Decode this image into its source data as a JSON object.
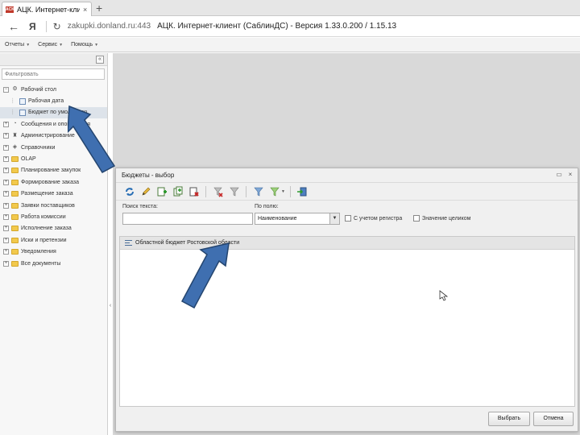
{
  "browser": {
    "tab_title": "АЦК. Интернет-клиент",
    "favicon_text": "ACK",
    "tab_close": "×",
    "new_tab": "+",
    "back": "←",
    "ya": "Я",
    "reload": "↻",
    "url": "zakupki.donland.ru:443",
    "page_title": "АЦК. Интернет-клиент (СаблинДС) - Версия 1.33.0.200 / 1.15.13"
  },
  "menu": {
    "items": [
      "Отчеты",
      "Сервис",
      "Помощь"
    ]
  },
  "left_panel": {
    "collapse": "«",
    "filter_placeholder": "Фильтровать",
    "tree": [
      {
        "label": "Рабочий стол",
        "level": 0,
        "expander": "−",
        "icon": "gear-icon"
      },
      {
        "label": "Рабочая дата",
        "level": 1,
        "icon": "doc-icon"
      },
      {
        "label": "Бюджет по умолчанию",
        "level": 1,
        "icon": "doc-icon",
        "selected": true
      },
      {
        "label": "Сообщения и оповещения",
        "level": 0,
        "expander": "+",
        "icon": "chat-icon"
      },
      {
        "label": "Администрирование",
        "level": 0,
        "expander": "+",
        "icon": "admin-icon"
      },
      {
        "label": "Справочники",
        "level": 0,
        "expander": "+",
        "icon": "book-icon"
      },
      {
        "label": "OLAP",
        "level": 0,
        "expander": "+",
        "icon": "folder-icon"
      },
      {
        "label": "Планирование закупок",
        "level": 0,
        "expander": "+",
        "icon": "folder-icon"
      },
      {
        "label": "Формирование заказа",
        "level": 0,
        "expander": "+",
        "icon": "folder-icon"
      },
      {
        "label": "Размещение заказа",
        "level": 0,
        "expander": "+",
        "icon": "folder-icon"
      },
      {
        "label": "Заявки поставщиков",
        "level": 0,
        "expander": "+",
        "icon": "folder-icon"
      },
      {
        "label": "Работа комиссии",
        "level": 0,
        "expander": "+",
        "icon": "folder-icon"
      },
      {
        "label": "Исполнение заказа",
        "level": 0,
        "expander": "+",
        "icon": "folder-icon"
      },
      {
        "label": "Иски и претензии",
        "level": 0,
        "expander": "+",
        "icon": "folder-icon"
      },
      {
        "label": "Уведомления",
        "level": 0,
        "expander": "+",
        "icon": "folder-icon"
      },
      {
        "label": "Все документы",
        "level": 0,
        "expander": "+",
        "icon": "folder-icon"
      }
    ]
  },
  "splitter": "‹",
  "dialog": {
    "title": "Бюджеты - выбор",
    "maximize": "▭",
    "close": "×",
    "toolbar_icons": [
      "refresh-icon",
      "edit-icon",
      "add-icon",
      "copy-icon",
      "delete-icon",
      "filter-clear-icon",
      "filter-icon",
      "filter-set-icon",
      "filter-menu-icon",
      "export-icon"
    ],
    "search_label": "Поиск текста:",
    "field_label": "По полю:",
    "field_value": "Наименование",
    "select_arrow": "▼",
    "case_label": "С учетом регистра",
    "whole_label": "Значение целиком",
    "rows": [
      "Областной бюджет Ростовской области"
    ],
    "select_button": "Выбрать",
    "cancel_button": "Отмена"
  },
  "colors": {
    "arrow": "#3f6fb0",
    "arrow_stroke": "#24456f",
    "workspace": "#d9d9d9"
  }
}
